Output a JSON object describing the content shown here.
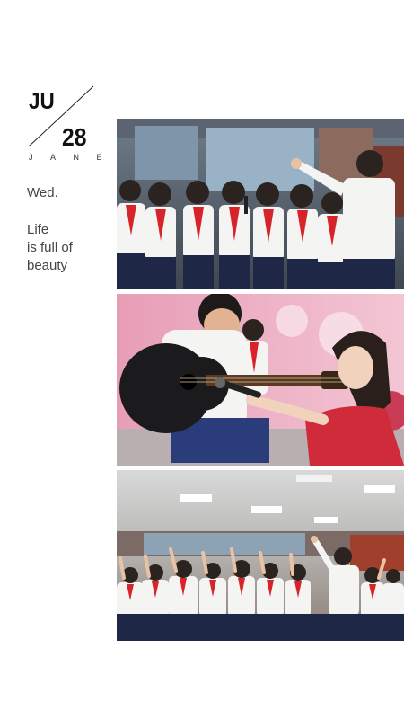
{
  "date": {
    "month": "JU",
    "day": "28",
    "name": "JANE"
  },
  "weekday": "Wed.",
  "motto": {
    "line1": "Life",
    "line2": "is full of",
    "line3": "beauty"
  },
  "photos": [
    {
      "subject": "children-choir-singing-with-microphones"
    },
    {
      "subject": "boy-playing-guitar-girl-holding-microphone"
    },
    {
      "subject": "children-choir-on-stage-raising-hands"
    }
  ],
  "colors": {
    "scarf_red": "#d8232a",
    "shirt_white": "#f4f4f2",
    "skirt_navy": "#1f2747",
    "stage_wood": "#a0402c",
    "banner_pink": "#e8a6c0"
  }
}
